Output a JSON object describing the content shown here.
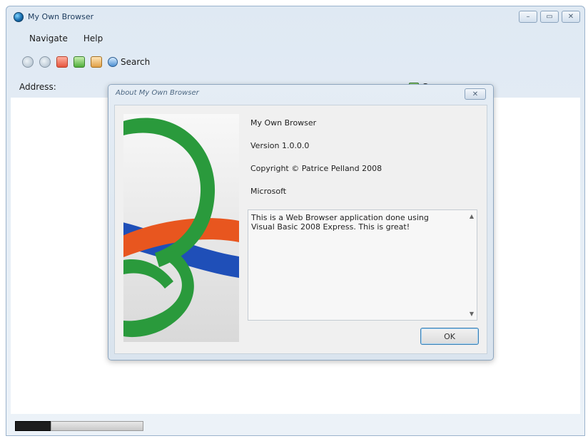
{
  "window": {
    "title": "My Own Browser",
    "caption_min": "–",
    "caption_max": "▭",
    "caption_close": "✕"
  },
  "menu": {
    "items": [
      {
        "label": "Navigate"
      },
      {
        "label": "Help"
      }
    ]
  },
  "toolbar": {
    "icons": [
      "back-icon",
      "forward-icon",
      "stop-icon",
      "refresh-icon",
      "home-icon",
      "search-icon"
    ],
    "search_label": "Search"
  },
  "address": {
    "label": "Address:",
    "go_label": "Go"
  },
  "status": {
    "progress": 0
  },
  "about_dialog": {
    "title": "About My Own Browser",
    "close_glyph": "✕",
    "product_name": "My Own Browser",
    "version": "Version 1.0.0.0",
    "copyright": "Copyright © Patrice Pelland 2008",
    "company": "Microsoft",
    "description": "This is a Web Browser application done using Visual Basic 2008 Express. This is great!",
    "scroll_up": "▲",
    "scroll_down": "▼",
    "ok_label": "OK"
  }
}
